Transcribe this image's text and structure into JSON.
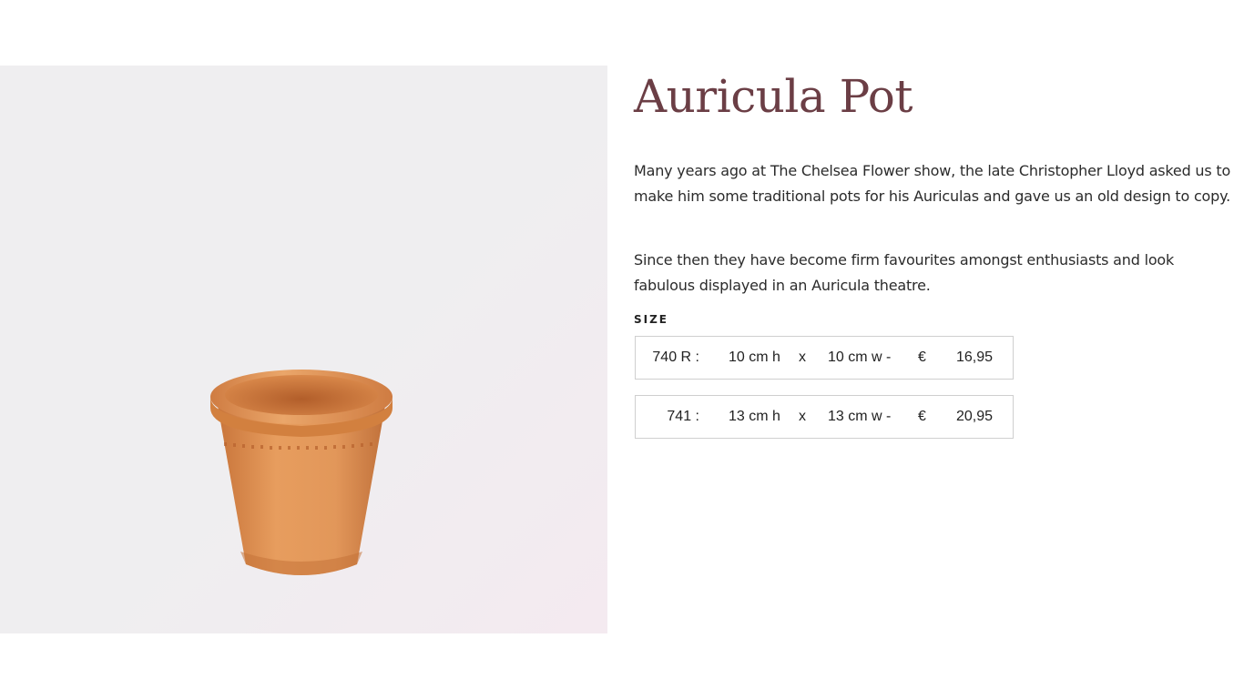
{
  "product": {
    "title": "Auricula Pot",
    "description": [
      "Many years ago at The Chelsea Flower show, the late Christopher Lloyd asked us to make him some traditional pots for his Auriculas and gave us an old design to copy.",
      "Since then they have become firm favourites amongst enthusiasts and look fabulous displayed in an Auricula theatre."
    ],
    "image_icon": "terracotta-pot-photo"
  },
  "size": {
    "label": "SIZE",
    "options": [
      {
        "code": "740 R :",
        "height": "10 cm  h",
        "x": "x",
        "width": "10 cm  w  -",
        "currency": "€",
        "price": "16,95"
      },
      {
        "code": "741 :",
        "height": "13 cm  h",
        "x": "x",
        "width": "13 cm  w  -",
        "currency": "€",
        "price": "20,95"
      }
    ]
  },
  "colors": {
    "title": "#6b3e45",
    "text": "#2b2b2b",
    "image_background": "#efeef0",
    "terracotta": "#d98a4a",
    "option_border": "#cfcfcf"
  }
}
